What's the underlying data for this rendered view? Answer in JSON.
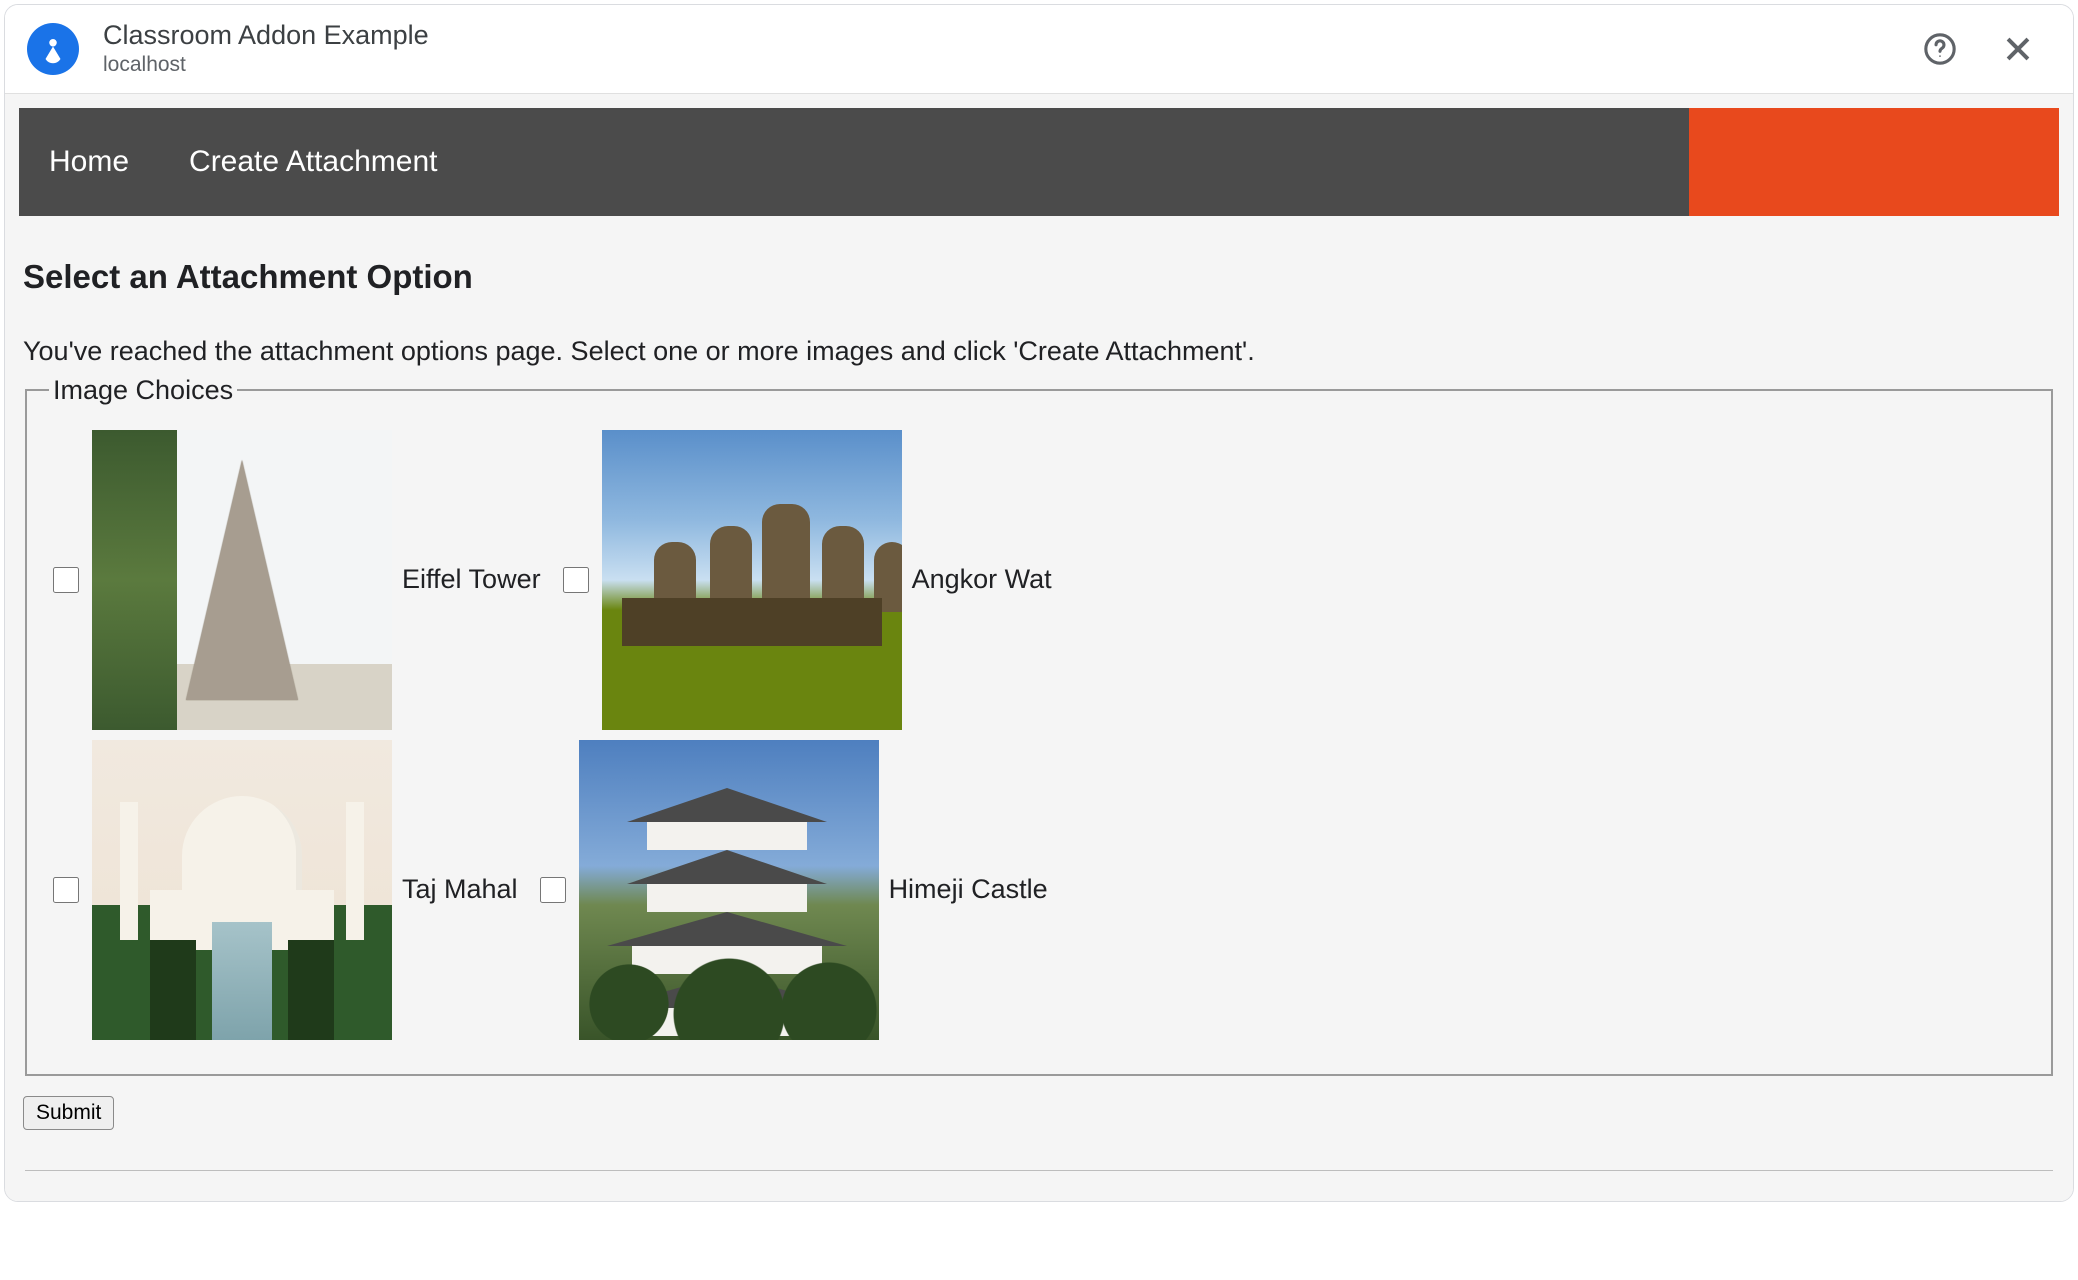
{
  "header": {
    "title": "Classroom Addon Example",
    "subtitle": "localhost"
  },
  "navbar": {
    "items": [
      {
        "label": "Home"
      },
      {
        "label": "Create Attachment"
      }
    ]
  },
  "page": {
    "heading": "Select an Attachment Option",
    "instruction": "You've reached the attachment options page. Select one or more images and click 'Create Attachment'.",
    "fieldset_legend": "Image Choices",
    "submit_label": "Submit"
  },
  "choices": [
    {
      "label": "Eiffel Tower",
      "checked": false
    },
    {
      "label": "Angkor Wat",
      "checked": false
    },
    {
      "label": "Taj Mahal",
      "checked": false
    },
    {
      "label": "Himeji Castle",
      "checked": false
    }
  ]
}
